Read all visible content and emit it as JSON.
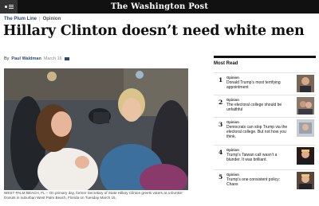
{
  "header": {
    "masthead": "The Washington Post"
  },
  "article": {
    "kicker": "The Plum Line",
    "category": "Opinion",
    "headline": "Hillary Clinton doesn’t need white men",
    "author_prefix": "By",
    "author": "Paul Waldman",
    "date": "March 16",
    "caption": "WEST PALM BEACH, FL – On primary day, former Secretary of State Hillary Clinton greets voters at a Dunkin' Donuts in suburban West Palm Beach, Florida on Tuesday March 15,"
  },
  "most_read": {
    "title": "Most Read",
    "items": [
      {
        "num": "1",
        "label": "Opinion",
        "text": "Donald Trump’s most terrifying appointment"
      },
      {
        "num": "2",
        "label": "Opinion",
        "text": "The electoral college should be unfaithful"
      },
      {
        "num": "3",
        "label": "Opinion",
        "text": "Democrats can stop Trump via the electoral college. But not how you think."
      },
      {
        "num": "4",
        "label": "Opinion",
        "text": "Trump’s Taiwan call wasn’t a blunder. It was brilliant."
      },
      {
        "num": "5",
        "label": "Opinion",
        "text": "Trump’s one consistent policy: Chaos"
      }
    ]
  },
  "colors": {
    "topbar": "#111111",
    "link_blue": "#2a4b7c"
  }
}
